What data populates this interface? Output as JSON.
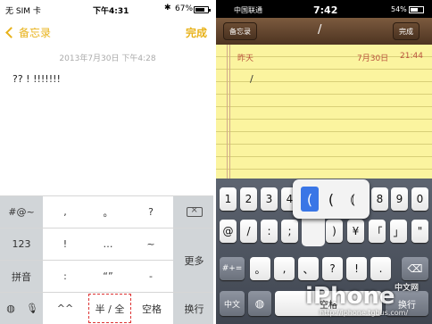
{
  "left": {
    "status": {
      "carrier": "无 SIM 卡",
      "time": "下午4:31",
      "bluetooth": "✱",
      "battery": "67%"
    },
    "nav": {
      "back": "备忘录",
      "done": "完成"
    },
    "date": "2013年7月30日 下午4:28",
    "note_text": "?? ! !!!!!!!",
    "keys": {
      "r1": [
        "#@~",
        ",",
        "。",
        "?"
      ],
      "r2": [
        "123",
        "!",
        "…",
        "~",
        "更多"
      ],
      "r3": [
        "拼音",
        ":",
        "“”",
        "-"
      ],
      "r4": [
        "^^",
        "半 / 全",
        "空格",
        "换行"
      ]
    }
  },
  "right": {
    "status": {
      "carrier": "中国联通",
      "time": "7:42",
      "battery": "54%"
    },
    "nav": {
      "left": "备忘录",
      "slash": "/",
      "done": "完成"
    },
    "note": {
      "yesterday": "昨天",
      "date": "7月30日",
      "time": "21:44",
      "text": "/"
    },
    "keys": {
      "r1": [
        "1",
        "2",
        "3",
        "4",
        "8",
        "9",
        "0"
      ],
      "r2": [
        "@",
        "/",
        ":",
        ";",
        ")",
        "¥",
        "「",
        "」",
        "\""
      ],
      "r3": [
        "#+=",
        "。",
        ",",
        "、",
        "?",
        "!",
        "."
      ],
      "r4": [
        "中文",
        "空格",
        "换行"
      ]
    },
    "popup": [
      "(",
      "(",
      "⦅"
    ],
    "watermark": {
      "brand": "iPhone",
      "cn": "中文网",
      "url": "http://iphone.tgbus.com/"
    }
  }
}
